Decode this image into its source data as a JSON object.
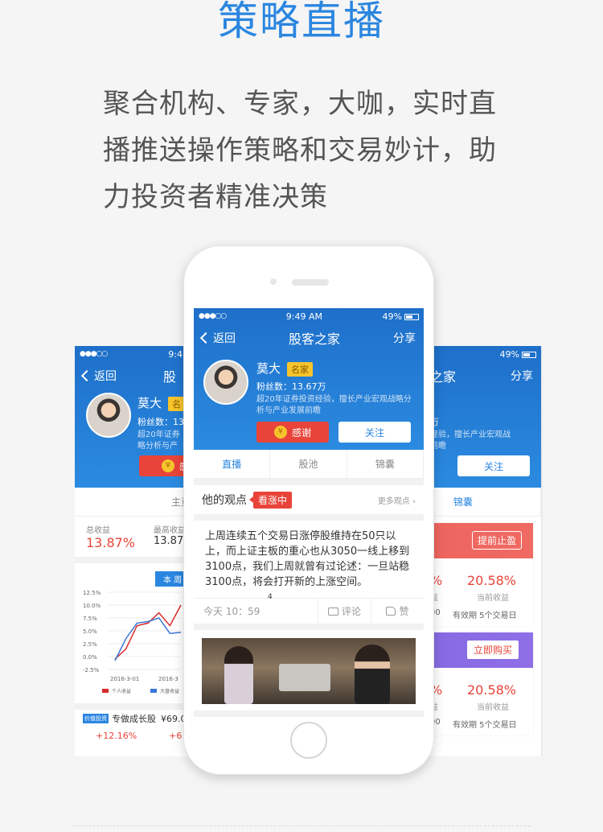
{
  "headline": "策略直播",
  "subtitle_lines": [
    "聚合机构、专家，大咖，实时直",
    "播推送操作策略和交易妙计，助",
    "力投资者精准决策"
  ],
  "phone": {
    "status": {
      "time": "9:49 AM",
      "battery": "49%"
    },
    "nav": {
      "back": "返回",
      "title": "股客之家",
      "share": "分享"
    },
    "profile": {
      "name": "莫大",
      "tag": "名家",
      "fans": "粉丝数：13.67万",
      "desc": "超20年证券投资经验，擅长产业宏观战略分析与产业发展前瞻",
      "thank": "感谢",
      "follow": "关注",
      "coin": "¥"
    },
    "tabs": [
      "直播",
      "股池",
      "锦囊"
    ],
    "opinion": {
      "title": "他的观点",
      "badge": "看涨中",
      "more": "更多观点"
    },
    "post": {
      "text": "上周连续五个交易日涨停股维持在50只以上，而上证主板的重心也从3050一线上移到3100点，我们上周就曾有过论述：一旦站稳3100点，将会打开新的上涨空间。",
      "num": "4",
      "time": "今天 10：59",
      "comment": "评论",
      "like": "赞"
    }
  },
  "left_screen": {
    "status_time": "9:4",
    "nav": {
      "back": "返回",
      "title": "股"
    },
    "profile": {
      "name": "莫大",
      "tag": "名",
      "fans": "粉丝数：13",
      "desc1": "超20年证券",
      "desc2": "略分析与产",
      "thank": "感"
    },
    "tabs": [
      "主页",
      "股"
    ],
    "stats": [
      {
        "label": "总收益",
        "value": "13.87%"
      },
      {
        "label": "最高收益",
        "value": "13.87%"
      }
    ],
    "chart_badge": "本 周",
    "product": {
      "tag": "价值投资",
      "name": "专做成长股",
      "price": "¥69.00",
      "red1": "+12.16%",
      "red2": "+6"
    }
  },
  "right_screen": {
    "status_battery": "49%",
    "nav": {
      "title": "之家",
      "share": "分享"
    },
    "profile": {
      "fans_tail": "万",
      "desc1": "经验，擅长产业宏观战",
      "desc2": "前瞻",
      "follow": "关注"
    },
    "tabs": [
      "锦囊"
    ],
    "cards": [
      {
        "stamp": "提前止盈",
        "pct_left": "%",
        "value": "20.58%",
        "label": "当前收益",
        "foot_left": "00",
        "foot": "有效期 5个交易日",
        "label_left": "益"
      },
      {
        "stamp": "立即购买",
        "pct_left": "%",
        "value": "20.58%",
        "label": "当前收益",
        "foot_left": "00",
        "foot": "有效期 5个交易日",
        "label_left": "益"
      }
    ]
  },
  "chart_data": {
    "type": "line",
    "x": [
      "2016-3-01",
      "2016-3"
    ],
    "yticks": [
      "12.5%",
      "10.0%",
      "7.5%",
      "5.0%",
      "2.5%",
      "0.0%",
      "-2.5%"
    ],
    "ylim": [
      -2.5,
      12.5
    ],
    "series": [
      {
        "name": "个人收益",
        "color": "#d92b2b",
        "values": [
          -0.5,
          1.5,
          6.0,
          6.5,
          8.5,
          6.0,
          10.0
        ]
      },
      {
        "name": "大盘收益",
        "color": "#3a76d6",
        "values": [
          -0.8,
          3.5,
          6.5,
          6.8,
          7.5,
          4.5,
          4.7
        ]
      }
    ]
  }
}
